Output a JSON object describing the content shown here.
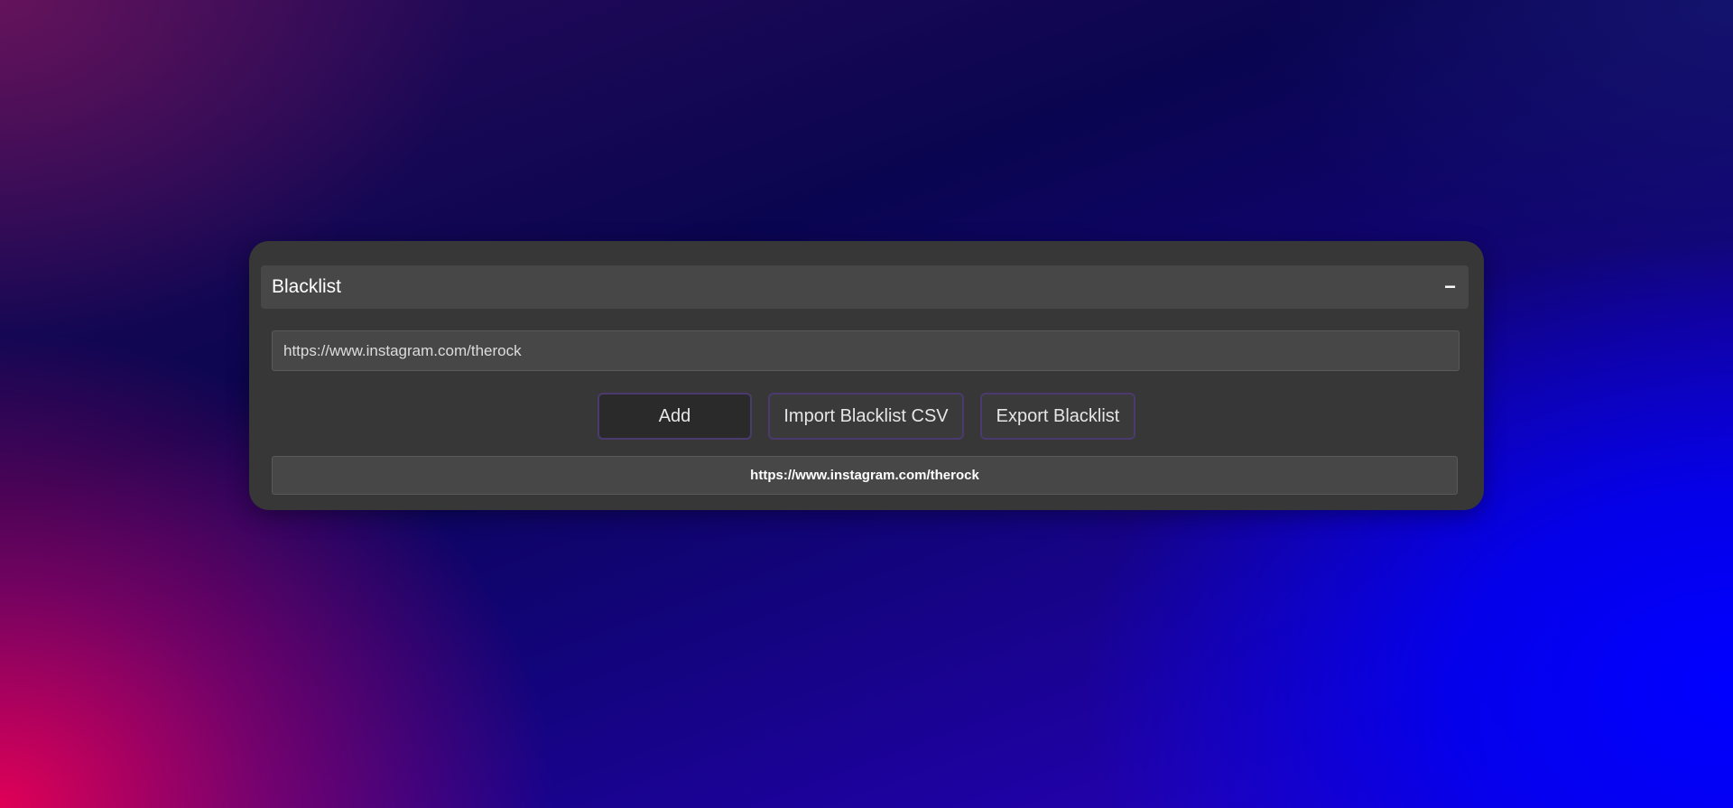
{
  "panel": {
    "title": "Blacklist",
    "collapse_symbol": "−"
  },
  "input": {
    "value": "https://www.instagram.com/therock",
    "placeholder": ""
  },
  "buttons": {
    "add_label": "Add",
    "import_label": "Import Blacklist CSV",
    "export_label": "Export Blacklist"
  },
  "blacklist": {
    "items": [
      {
        "url": "https://www.instagram.com/therock"
      }
    ]
  },
  "colors": {
    "panel_bg": "#373737",
    "header_bg": "#474747",
    "button_border": "#4b3a6e",
    "background_pink": "#eb0055",
    "background_blue": "#0000ff",
    "background_navy": "#07054a"
  }
}
